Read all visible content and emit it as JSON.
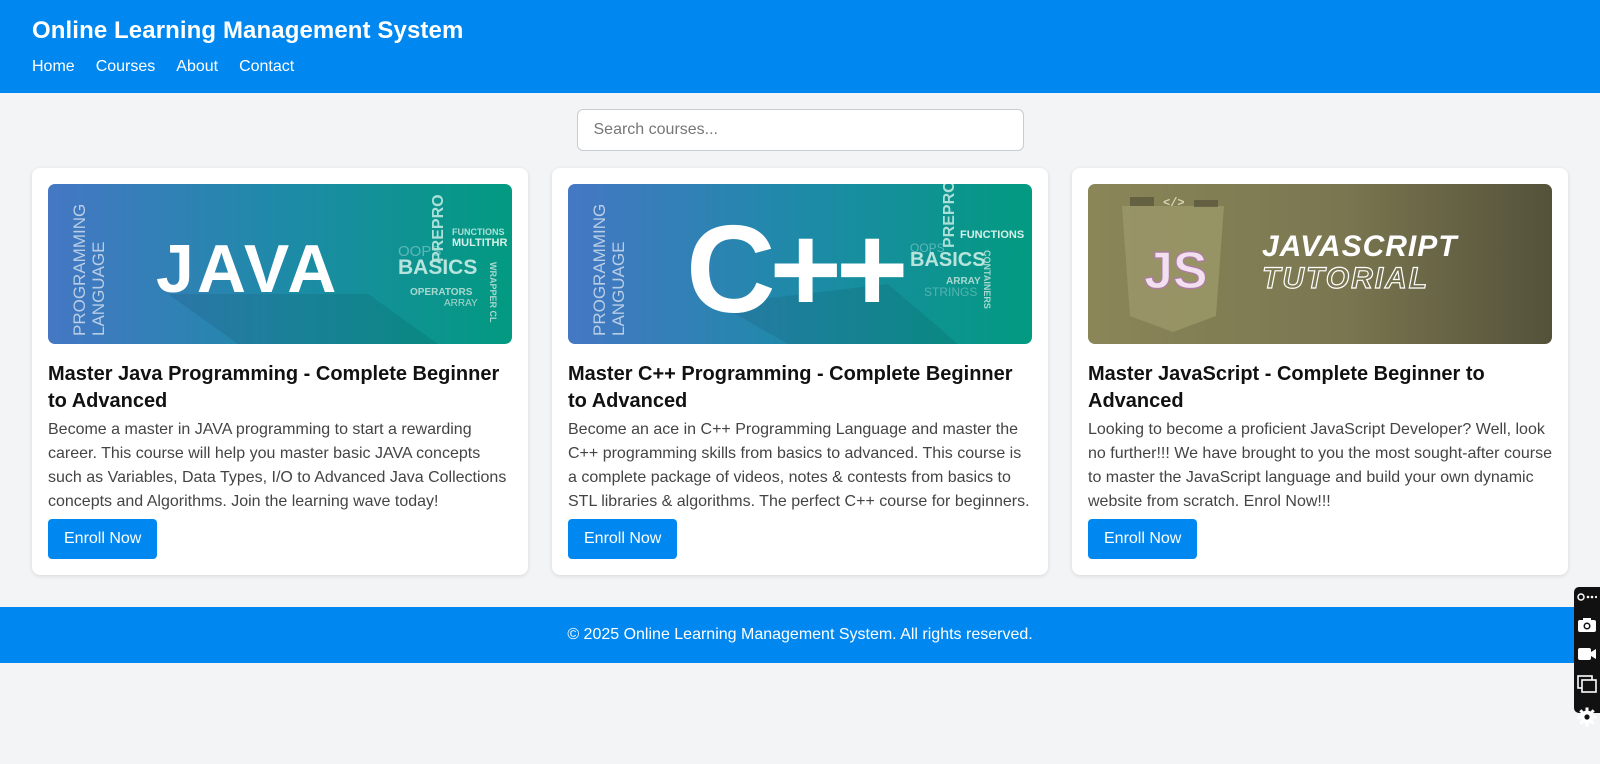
{
  "header": {
    "title": "Online Learning Management System",
    "nav": [
      "Home",
      "Courses",
      "About",
      "Contact"
    ]
  },
  "search": {
    "placeholder": "Search courses..."
  },
  "courses": [
    {
      "title": "Master Java Programming - Complete Beginner to Advanced",
      "description": "Become a master in JAVA programming to start a rewarding career. This course will help you master basic JAVA concepts such as Variables, Data Types, I/O to Advanced Java Collections concepts and Algorithms. Join the learning wave today!",
      "button": "Enroll Now",
      "image": {
        "main": "JAVA",
        "side_vertical": [
          "PROGRAMMING",
          "LANGUAGE"
        ],
        "tags": [
          "OOPS",
          "PREPRO",
          "FUNCTIONS",
          "MULTITHR",
          "BASICS",
          "OPERATORS",
          "ARRAY",
          "WRAPPER CL"
        ]
      }
    },
    {
      "title": "Master C++ Programming - Complete Beginner to Advanced",
      "description": "Become an ace in C++ Programming Language and master the C++ programming skills from basics to advanced. This course is a complete package of videos, notes & contests from basics to STL libraries & algorithms. The perfect C++ course for beginners.",
      "button": "Enroll Now",
      "image": {
        "main": "C++",
        "side_vertical": [
          "PROGRAMMING",
          "LANGUAGE"
        ],
        "tags": [
          "OOPS",
          "PREPRO",
          "FUNCTIONS",
          "BASICS",
          "ARRAY",
          "STRINGS",
          "CONTAINERS"
        ]
      }
    },
    {
      "title": "Master JavaScript - Complete Beginner to Advanced",
      "description": "Looking to become a proficient JavaScript Developer? Well, look no further!!! We have brought to you the most sought-after course to master the JavaScript language and build your own dynamic website from scratch. Enrol Now!!!",
      "button": "Enroll Now",
      "image": {
        "badge": "JS",
        "code": "</>",
        "line1": "JAVASCRIPT",
        "line2": "TUTORIAL"
      }
    }
  ],
  "footer": {
    "text": "© 2025 Online Learning Management System. All rights reserved."
  },
  "toolbar": {
    "icons": [
      "pin-icon",
      "camera-icon",
      "video-icon",
      "windows-icon",
      "gear-icon"
    ]
  },
  "colors": {
    "brand": "#0088f0",
    "background": "#f3f4f6"
  }
}
